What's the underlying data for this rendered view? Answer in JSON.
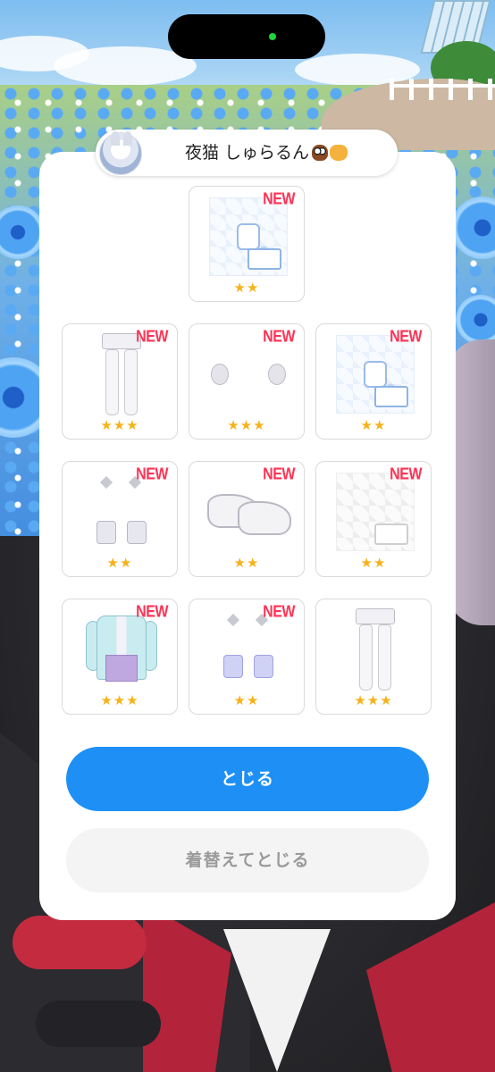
{
  "user": {
    "name": "夜猫 しゅらるん",
    "emoji": [
      "owl-emoji",
      "cat-emoji"
    ]
  },
  "items": [
    {
      "new_label": "NEW",
      "stars": "★★",
      "rarity": 2,
      "icon": "pattern-background-icon"
    },
    {
      "new_label": "NEW",
      "stars": "★★★",
      "rarity": 3,
      "icon": "shorts-stockings-icon"
    },
    {
      "new_label": "NEW",
      "stars": "★★★",
      "rarity": 3,
      "icon": "bunny-ears-icon"
    },
    {
      "new_label": "NEW",
      "stars": "★★",
      "rarity": 2,
      "icon": "pattern-background-icon"
    },
    {
      "new_label": "NEW",
      "stars": "★★",
      "rarity": 2,
      "icon": "earrings-icon"
    },
    {
      "new_label": "NEW",
      "stars": "★★",
      "rarity": 2,
      "icon": "sneakers-icon"
    },
    {
      "new_label": "NEW",
      "stars": "★★",
      "rarity": 2,
      "icon": "pattern-background-grey-icon"
    },
    {
      "new_label": "NEW",
      "stars": "★★★",
      "rarity": 3,
      "icon": "jacket-outfit-icon"
    },
    {
      "new_label": "NEW",
      "stars": "★★",
      "rarity": 2,
      "icon": "earrings-purple-icon"
    },
    {
      "new_label": "",
      "stars": "★★★",
      "rarity": 3,
      "icon": "shorts-stockings-icon"
    }
  ],
  "buttons": {
    "close": "とじる",
    "change_and_close": "着替えてとじる"
  },
  "colors": {
    "accent": "#1e90f5",
    "new_badge": "#ff3355",
    "star": "#f6b21b",
    "status_dot": "#1bd63c"
  }
}
